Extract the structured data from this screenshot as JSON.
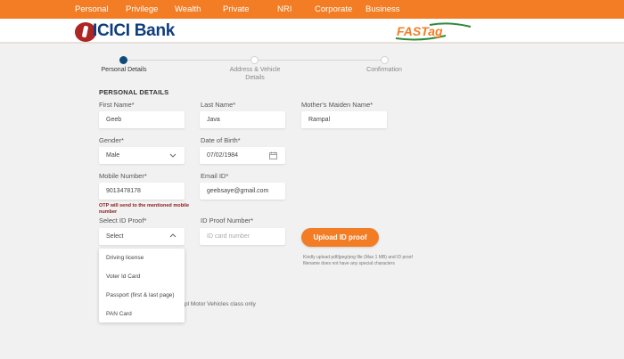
{
  "topnav": {
    "items": [
      "Personal",
      "Privilege",
      "Wealth",
      "Private",
      "NRI",
      "Corporate",
      "Business"
    ]
  },
  "header": {
    "brand_name": "ICICI Bank",
    "fastag_text": "FASTag",
    "brand_color": "#0f3d7c",
    "brand_mark_color": "#ad2524",
    "fastag_color": "#f27d24"
  },
  "stepper": {
    "steps": [
      {
        "label": "Personal Details",
        "state": "active"
      },
      {
        "label": "Address & Vehicle Details",
        "state": "inactive"
      },
      {
        "label": "Confirmation",
        "state": "inactive"
      }
    ]
  },
  "form": {
    "section_title": "PERSONAL DETAILS",
    "first_name": {
      "label": "First Name*",
      "value": "Geeb"
    },
    "last_name": {
      "label": "Last Name*",
      "value": "Java"
    },
    "mothers_maiden_name": {
      "label": "Mother's Maiden Name*",
      "value": "Rampal"
    },
    "gender": {
      "label": "Gender*",
      "value": "Male"
    },
    "dob": {
      "label": "Date of Birth*",
      "value": "07/02/1984"
    },
    "mobile": {
      "label": "Mobile Number*",
      "value": "9013478178"
    },
    "email": {
      "label": "Email ID*",
      "value": "geebsaye@gmail.com"
    },
    "otp_note": "OTP will send to the mentioned mobile number",
    "id_proof": {
      "label": "Select ID Proof*",
      "value": "Select"
    },
    "id_proof_number": {
      "label": "ID Proof Number*",
      "placeholder": "ID card number"
    },
    "upload_button": "Upload ID proof",
    "upload_note": "Kindly upload pdf/jpeg/png file (Max 1 MB) and ID proof filename does not have any special characters",
    "id_proof_options": [
      "Driving license",
      "Voter Id Card",
      "Passport (first & last page)",
      "PAN Card"
    ],
    "footnote": "pl Motor Vehicles class only"
  },
  "colors": {
    "accent": "#f27d24",
    "stepper_active": "#0e4a7a",
    "otp_note": "#8b1a1a",
    "background": "#f1f1f1"
  }
}
